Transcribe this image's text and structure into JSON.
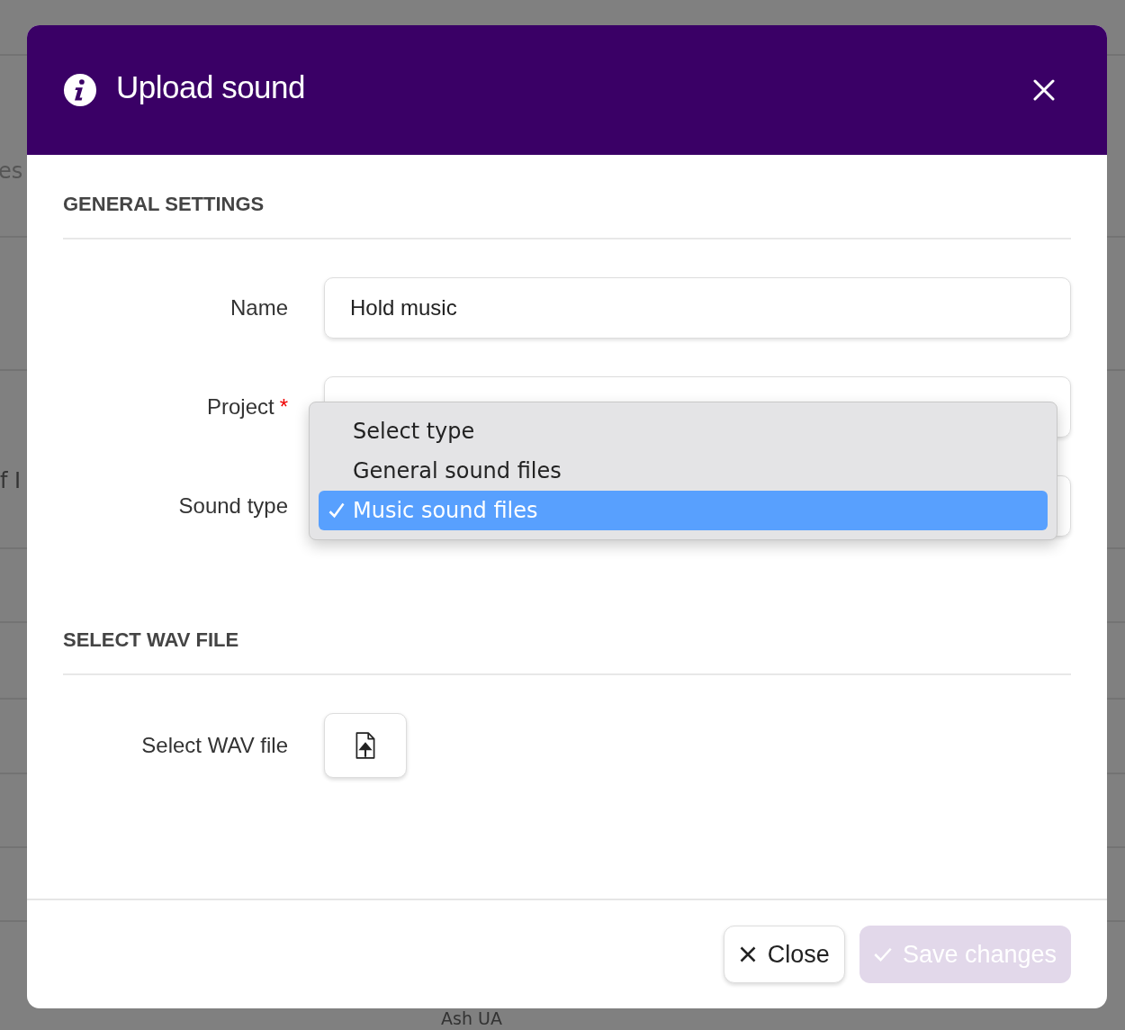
{
  "background": {
    "left_top_text": "es",
    "left_middle_text": "f I",
    "bottom_text": "Ash UA"
  },
  "dialog": {
    "title": "Upload sound",
    "sections": [
      {
        "heading": "GENERAL SETTINGS",
        "fields": [
          {
            "label": "Name",
            "kind": "text",
            "value": "Hold music"
          },
          {
            "label": "Project",
            "kind": "select",
            "required_mark": "*"
          },
          {
            "label": "Sound type",
            "kind": "select"
          }
        ]
      },
      {
        "heading": "SELECT WAV FILE",
        "fields": [
          {
            "label": "Select WAV file",
            "kind": "file"
          }
        ]
      }
    ],
    "dropdown": {
      "options": [
        {
          "label": "Select type",
          "selected": false
        },
        {
          "label": "General sound files",
          "selected": false
        },
        {
          "label": "Music sound files",
          "selected": true
        }
      ]
    },
    "buttons": [
      {
        "label": "Close",
        "kind": "close"
      },
      {
        "label": "Save changes",
        "kind": "save",
        "disabled": true
      }
    ]
  }
}
